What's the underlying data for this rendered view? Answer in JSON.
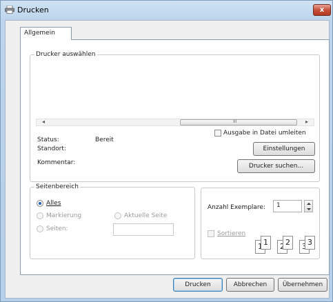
{
  "window": {
    "title": "Drucken",
    "close_glyph": "x"
  },
  "tabs": [
    {
      "label": "Allgemein"
    }
  ],
  "printer_group": {
    "legend": "Drucker auswählen",
    "scroll_left": "◂",
    "scroll_right": "▸",
    "scroll_grip": "III",
    "status_label": "Status:",
    "status_value": "Bereit",
    "location_label": "Standort:",
    "comment_label": "Kommentar:",
    "print_to_file": "Ausgabe in Datei umleiten",
    "settings_button": "Einstellungen",
    "find_printer_button": "Drucker suchen..."
  },
  "range_group": {
    "legend": "Seitenbereich",
    "all": "Alles",
    "selection": "Markierung",
    "current_page": "Aktuelle Seite",
    "pages": "Seiten:",
    "selected": "all"
  },
  "copies_group": {
    "copies_label": "Anzahl Exemplare:",
    "copies_value": "1",
    "collate_label": "Sortieren",
    "pages_illustration": [
      "1",
      "1",
      "2",
      "2",
      "3",
      "3"
    ]
  },
  "buttons": {
    "print": "Drucken",
    "cancel": "Abbrechen",
    "apply": "Übernehmen"
  },
  "colors": {
    "title_gradient_top": "#cfe2f3",
    "close_red": "#c8503a",
    "radio_dot": "#1e5fb4"
  }
}
